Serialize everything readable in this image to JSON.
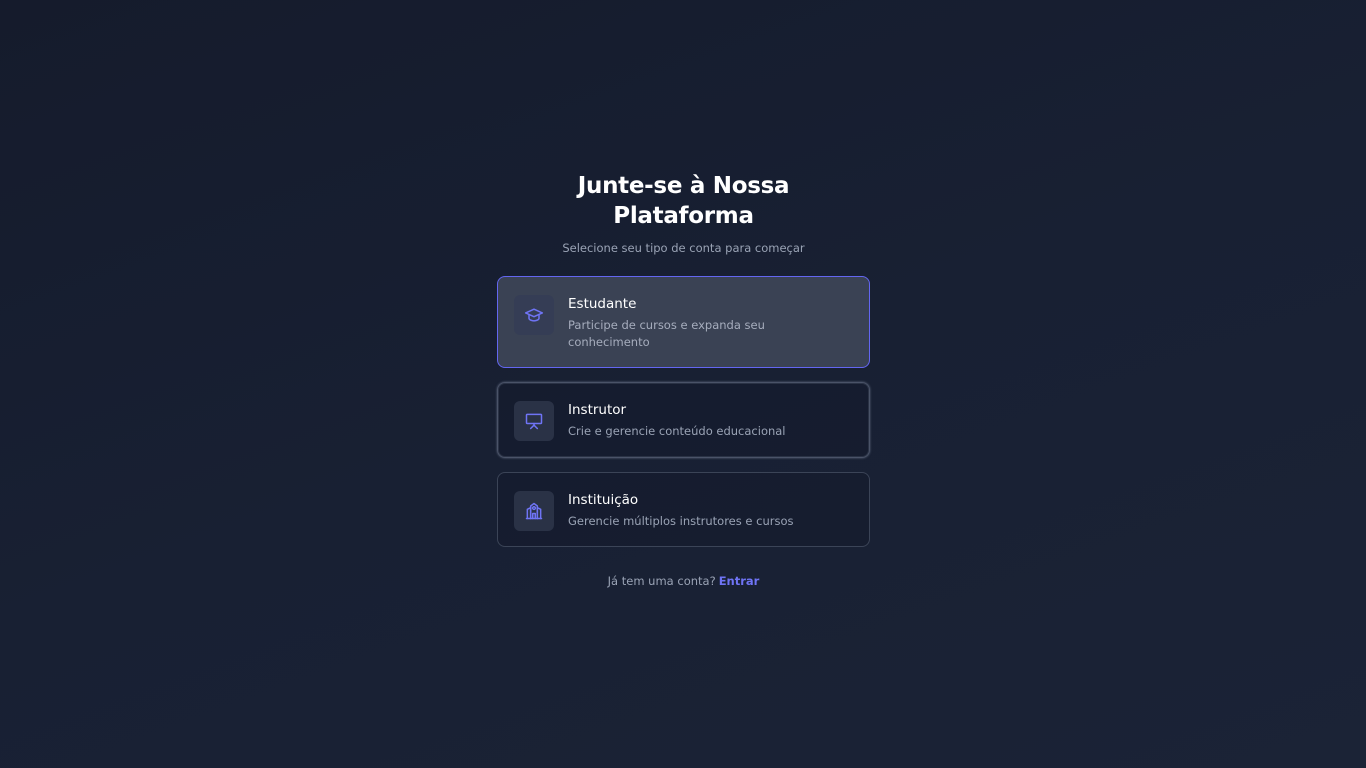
{
  "header": {
    "title": "Junte-se à Nossa Plataforma",
    "subtitle": "Selecione seu tipo de conta para começar"
  },
  "account_types": [
    {
      "title": "Estudante",
      "description": "Participe de cursos e expanda seu conhecimento",
      "icon": "graduation-cap-icon",
      "selected": true
    },
    {
      "title": "Instrutor",
      "description": "Crie e gerencie conteúdo educacional",
      "icon": "presentation-board-icon",
      "selected": false
    },
    {
      "title": "Instituição",
      "description": "Gerencie múltiplos instrutores e cursos",
      "icon": "school-building-icon",
      "selected": false
    }
  ],
  "footer": {
    "prompt": "Já tem uma conta?",
    "login_link": "Entrar"
  },
  "colors": {
    "accent": "#6366f1",
    "background": "#182033",
    "muted_text": "#9aa3b5"
  }
}
